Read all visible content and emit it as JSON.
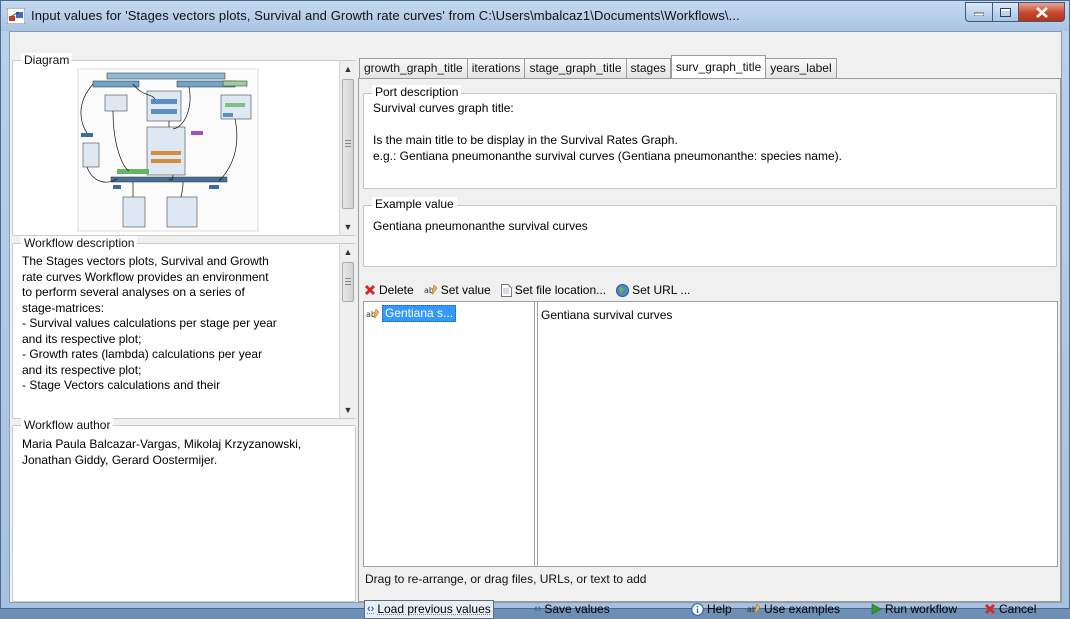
{
  "window": {
    "title": "Input values for 'Stages vectors plots, Survival and Growth rate curves' from C:\\Users\\mbalcaz1\\Documents\\Workflows\\..."
  },
  "diagram": {
    "legend": "Diagram"
  },
  "workflow_description": {
    "legend": "Workflow description",
    "lines": [
      "The Stages vectors plots, Survival and Growth",
      "rate curves Workflow provides an environment",
      "to perform several analyses on a series of",
      "stage-matrices:",
      "- Survival values calculations per stage per year",
      "and its respective plot;",
      "- Growth rates (lambda) calculations per year",
      "and its respective plot;",
      "- Stage Vectors calculations and their"
    ]
  },
  "workflow_author": {
    "legend": "Workflow author",
    "lines": [
      "Maria Paula Balcazar-Vargas, Mikolaj Krzyzanowski,",
      "Jonathan Giddy, Gerard Oostermijer."
    ]
  },
  "tabs": [
    "growth_graph_title",
    "iterations",
    "stage_graph_title",
    "stages",
    "surv_graph_title",
    "years_label"
  ],
  "active_tab": "surv_graph_title",
  "port_description": {
    "legend": "Port description",
    "lines": [
      "Survival curves graph title:",
      "",
      "Is the main title to be display in the Survival Rates Graph.",
      "e.g.: Gentiana pneumonanthe survival curves (Gentiana pneumonanthe: species name)."
    ]
  },
  "example_value": {
    "legend": "Example value",
    "text": "Gentiana pneumonanthe survival curves"
  },
  "toolbar": {
    "delete": "Delete",
    "set_value": "Set value",
    "set_file_location": "Set file location...",
    "set_url": "Set URL ..."
  },
  "values_list": {
    "selected_item": "Gentiana s...",
    "value_text": "Gentiana survival curves"
  },
  "hint": "Drag to re-arrange, or drag files, URLs, or text to add",
  "bottom": {
    "load_previous": "Load previous values",
    "save_values": "Save values",
    "help": "Help",
    "use_examples": "Use examples",
    "run_workflow": "Run workflow",
    "cancel": "Cancel"
  },
  "colors": {
    "accent_blue": "#3399ff",
    "run_green": "#2e9e2e",
    "cancel_red": "#d02a2a"
  }
}
